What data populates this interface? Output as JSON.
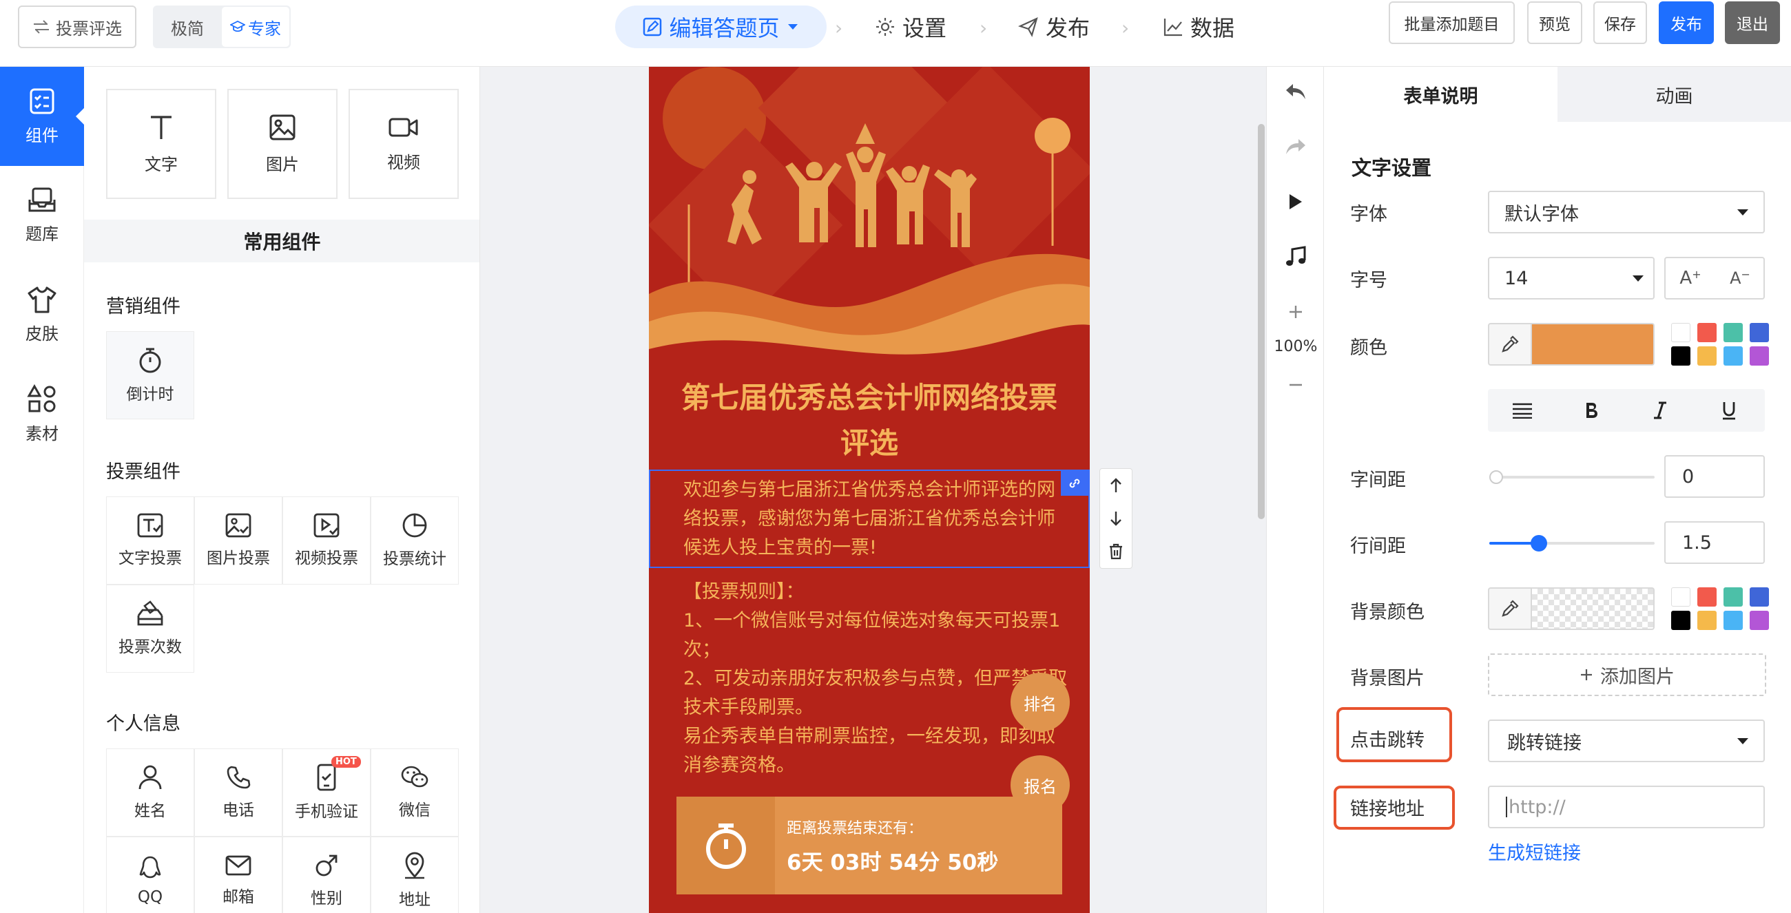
{
  "topbar": {
    "back_label": "投票评选",
    "mode_simple": "极简",
    "mode_expert": "专家",
    "steps": {
      "edit": "编辑答题页",
      "settings": "设置",
      "publish": "发布",
      "data": "数据"
    },
    "buttons": {
      "batch_add": "批量添加题目",
      "preview": "预览",
      "save": "保存",
      "publish": "发布",
      "exit": "退出"
    }
  },
  "leftnav": {
    "components": "组件",
    "bank": "题库",
    "skin": "皮肤",
    "material": "素材"
  },
  "components": {
    "basic": {
      "text": "文字",
      "image": "图片",
      "video": "视频"
    },
    "common_title": "常用组件",
    "marketing_title": "营销组件",
    "marketing": {
      "countdown": "倒计时"
    },
    "vote_title": "投票组件",
    "vote": {
      "text_vote": "文字投票",
      "image_vote": "图片投票",
      "video_vote": "视频投票",
      "vote_stats": "投票统计",
      "vote_count": "投票次数"
    },
    "personal_title": "个人信息",
    "personal": {
      "name": "姓名",
      "phone": "电话",
      "mobile_verify": "手机验证",
      "hot": "HOT",
      "wechat": "微信",
      "qq": "QQ",
      "email": "邮箱",
      "gender": "性别",
      "address": "地址"
    }
  },
  "canvas": {
    "title": "第七届优秀总会计师网络投票评选",
    "intro": "欢迎参与第七届浙江省优秀总会计师评选的网络投票，感谢您为第七届浙江省优秀总会计师候选人投上宝贵的一票!",
    "rules": [
      "【投票规则】：",
      "1、一个微信账号对每位候选对象每天可投票1次；",
      "2、可发动亲朋好友积极参与点赞，但严禁采取技术手段刷票。",
      "易企秀表单自带刷票监控，一经发现，即刻取消参赛资格。"
    ],
    "rank_btn": "排名",
    "signup_btn": "报名",
    "countdown_label": "距离投票结束还有：",
    "countdown_value": "6天 03时 54分 50秒"
  },
  "vtools": {
    "zoom": "100%"
  },
  "rightpanel": {
    "tab_form": "表单说明",
    "tab_anim": "动画",
    "text_settings": "文字设置",
    "font_label": "字体",
    "font_value": "默认字体",
    "size_label": "字号",
    "size_value": "14",
    "size_up": "A",
    "size_down": "A",
    "color_label": "颜色",
    "color_value": "#e8944a",
    "letter_spacing_label": "字间距",
    "letter_spacing_value": "0",
    "line_height_label": "行间距",
    "line_height_value": "1.5",
    "line_height_fraction": 0.3,
    "bg_color_label": "背景颜色",
    "bg_image_label": "背景图片",
    "add_image": "添加图片",
    "click_jump_label": "点击跳转",
    "click_jump_value": "跳转链接",
    "link_label": "链接地址",
    "link_placeholder": "http://",
    "short_link": "生成短链接",
    "palette": [
      "#ffffff",
      "#f25a4c",
      "#4cc0a8",
      "#3f66d8",
      "#000000",
      "#f5b94a",
      "#4ab4f5",
      "#b356d6"
    ]
  }
}
